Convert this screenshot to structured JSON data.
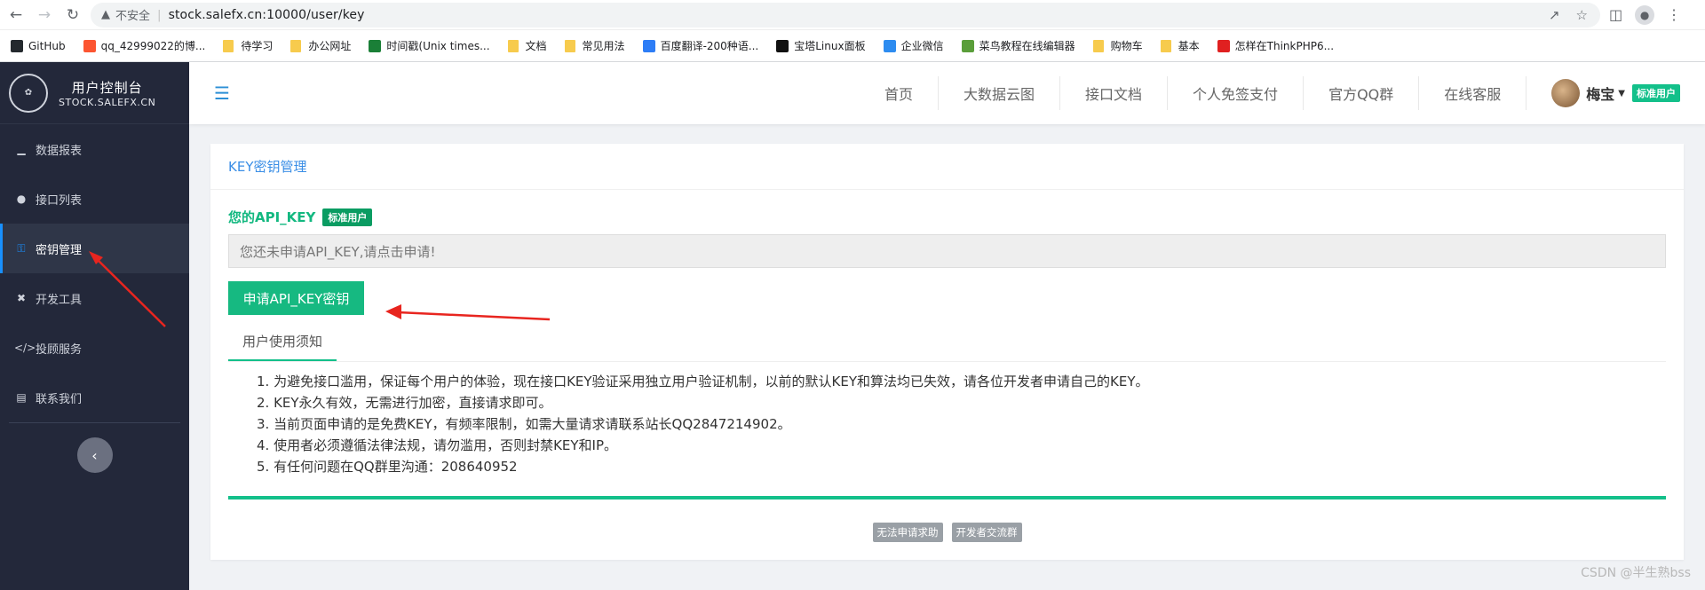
{
  "browser": {
    "insecure_label": "不安全",
    "url": "stock.salefx.cn:10000/user/key"
  },
  "bookmarks": [
    {
      "label": "GitHub",
      "icon": "github-icon",
      "color": "#24292e"
    },
    {
      "label": "qq_42999022的博...",
      "icon": "csdn-icon",
      "color": "#fc5531"
    },
    {
      "label": "待学习",
      "icon": "folder-icon",
      "color": "#f7cb4d"
    },
    {
      "label": "办公网址",
      "icon": "folder-icon",
      "color": "#f7cb4d"
    },
    {
      "label": "时间戳(Unix times...",
      "icon": "timestamp-icon",
      "color": "#1a7f37"
    },
    {
      "label": "文档",
      "icon": "folder-icon",
      "color": "#f7cb4d"
    },
    {
      "label": "常见用法",
      "icon": "folder-icon",
      "color": "#f7cb4d"
    },
    {
      "label": "百度翻译-200种语...",
      "icon": "translate-icon",
      "color": "#2d7df6"
    },
    {
      "label": "宝塔Linux面板",
      "icon": "bt-icon",
      "color": "#111"
    },
    {
      "label": "企业微信",
      "icon": "wecom-icon",
      "color": "#2d8cf0"
    },
    {
      "label": "菜鸟教程在线编辑器",
      "icon": "runoob-icon",
      "color": "#5a9e3a"
    },
    {
      "label": "购物车",
      "icon": "folder-icon",
      "color": "#f7cb4d"
    },
    {
      "label": "基本",
      "icon": "folder-icon",
      "color": "#f7cb4d"
    },
    {
      "label": "怎样在ThinkPHP6...",
      "icon": "php-icon",
      "color": "#e02020"
    }
  ],
  "brand": {
    "title": "用户控制台",
    "subtitle": "STOCK.SALEFX.CN"
  },
  "sidebar": {
    "items": [
      {
        "label": "数据报表",
        "icon": "chart-icon"
      },
      {
        "label": "接口列表",
        "icon": "api-icon"
      },
      {
        "label": "密钥管理",
        "icon": "key-icon"
      },
      {
        "label": "开发工具",
        "icon": "tools-icon"
      },
      {
        "label": "投顾服务",
        "icon": "code-icon"
      },
      {
        "label": "联系我们",
        "icon": "contact-card-icon"
      }
    ],
    "active_index": 2
  },
  "topnav": {
    "items": [
      "首页",
      "大数据云图",
      "接口文档",
      "个人免签支付",
      "官方QQ群",
      "在线客服"
    ],
    "user_name": "梅宝",
    "user_badge": "标准用户"
  },
  "card": {
    "title": "KEY密钥管理",
    "key_label": "您的API_KEY",
    "key_badge": "标准用户",
    "key_placeholder": "您还未申请API_KEY,请点击申请!",
    "apply_button": "申请API_KEY密钥",
    "tab": "用户使用须知",
    "notices": [
      "1. 为避免接口滥用，保证每个用户的体验，现在接口KEY验证采用独立用户验证机制，以前的默认KEY和算法均已失效，请各位开发者申请自己的KEY。",
      "2. KEY永久有效，无需进行加密，直接请求即可。",
      "3. 当前页面申请的是免费KEY，有频率限制，如需大量请求请联系站长QQ2847214902。",
      "4. 使用者必须遵循法律法规，请勿滥用，否则封禁KEY和IP。",
      "5. 有任何问题在QQ群里沟通：208640952"
    ],
    "footer_buttons": [
      "无法申请求助",
      "开发者交流群"
    ]
  },
  "watermark": "CSDN @半生熟bss",
  "colors": {
    "sidebar_bg": "#23283a",
    "accent_green": "#13c08a",
    "accent_blue": "#3a8ee6",
    "annotation_red": "#e8251f"
  }
}
